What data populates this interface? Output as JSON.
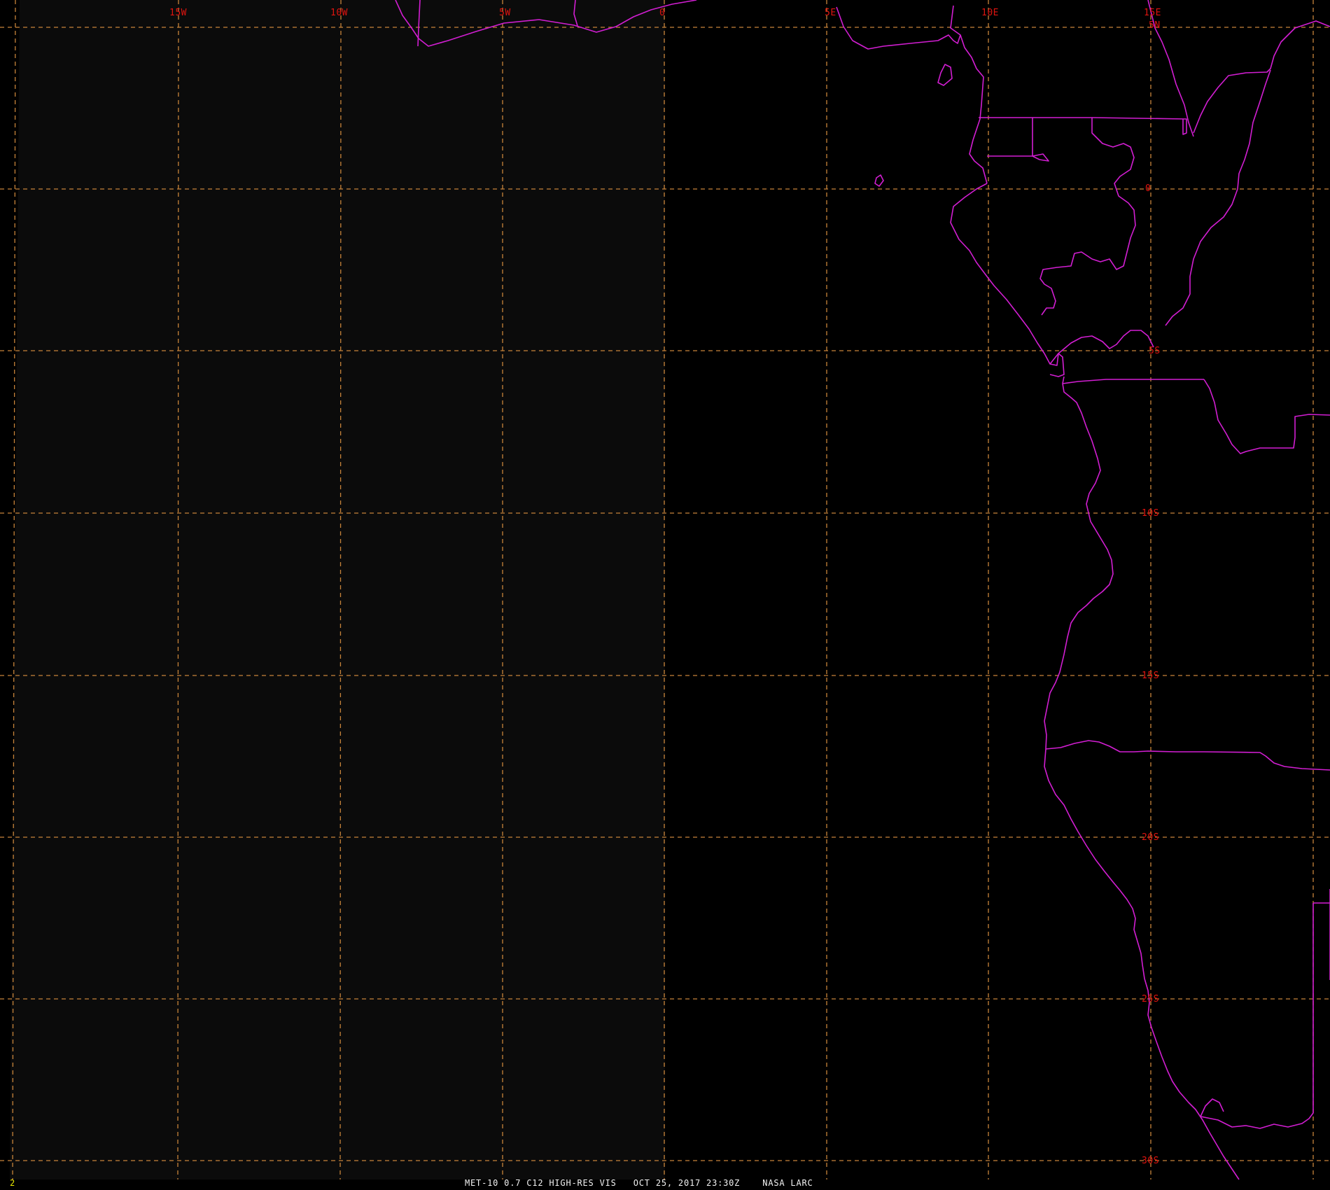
{
  "viewer": {
    "frame_number": "2",
    "caption": "MET-10 0.7 C12 HIGH-RES VIS   OCT 25, 2017 23:30Z    NASA LARC"
  },
  "graticule": {
    "longitude_labels": [
      "15W",
      "10W",
      "5W",
      "0",
      "5E",
      "10E",
      "15E"
    ],
    "latitude_labels": [
      "5N",
      "0",
      "5S",
      "10S",
      "15S",
      "20S",
      "25S",
      "30S"
    ]
  },
  "colors": {
    "background": "#000000",
    "no_data_region": "#0b0b0b",
    "graticule": "#c8843a",
    "coastline": "#d21ed2",
    "label": "#e0140f",
    "footer_text": "#f2f2f2",
    "frame_number": "#e7e700"
  },
  "icons": {
    "map": "satellite-map"
  }
}
